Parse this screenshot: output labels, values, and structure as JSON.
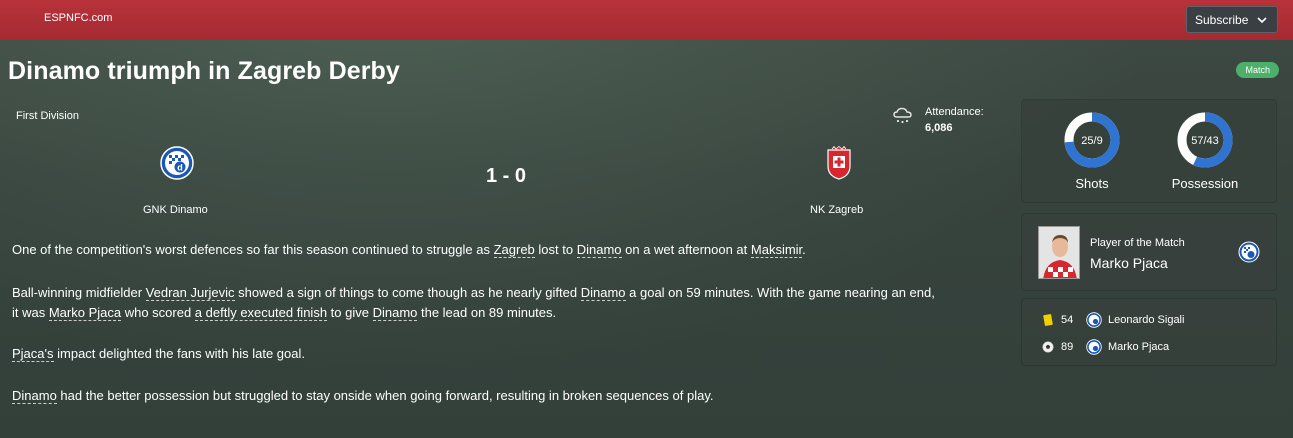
{
  "header": {
    "brand": "ESPNFC.com",
    "subscribe_label": "Subscribe"
  },
  "article": {
    "title": "Dinamo triumph in Zagreb Derby",
    "badge": "Match"
  },
  "match": {
    "competition": "First Division",
    "weather_icon": "cloud-rain-icon",
    "attendance_label": "Attendance:",
    "attendance_value": "6,086",
    "home_team": "GNK Dinamo",
    "away_team": "NK Zagreb",
    "score": "1 - 0"
  },
  "report": {
    "p1": {
      "a": "One of the competition's worst defences so far this season continued to struggle as ",
      "b": "Zagreb",
      "c": " lost to ",
      "d": "Dinamo",
      "e": " on a wet afternoon at ",
      "f": "Maksimir",
      "g": "."
    },
    "p2": {
      "a": "Ball-winning midfielder ",
      "b": "Vedran Jurjevic",
      "c": " showed a sign of things to come though as he nearly gifted ",
      "d": "Dinamo",
      "e": " a goal on 59 minutes. With the game nearing an end,"
    },
    "p3": {
      "a": "it was ",
      "b": "Marko Pjaca",
      "c": " who scored ",
      "d": "a deftly executed finish",
      "e": " to give ",
      "f": "Dinamo",
      "g": " the lead on 89 minutes."
    },
    "p4": {
      "a": "Pjaca's",
      "b": " impact delighted the fans with his late goal."
    },
    "p5": {
      "a": "Dinamo",
      "b": " had the better possession but struggled to stay onside when going forward, resulting in broken sequences of play."
    }
  },
  "stats": {
    "shots": {
      "label": "Shots",
      "value": "25/9",
      "share": 0.735
    },
    "possession": {
      "label": "Possession",
      "value": "57/43",
      "share": 0.57
    },
    "home_color": "#2f74d0",
    "away_color": "#ffffff"
  },
  "player_of_match": {
    "label": "Player of the Match",
    "name": "Marko Pjaca"
  },
  "events": [
    {
      "type": "yellow-card-icon",
      "minute": "54",
      "player": "Leonardo Sigali"
    },
    {
      "type": "goal-ball-icon",
      "minute": "89",
      "player": "Marko Pjaca"
    }
  ],
  "colors": {
    "topbar": "#b8323a",
    "badge": "#4caf6a"
  }
}
